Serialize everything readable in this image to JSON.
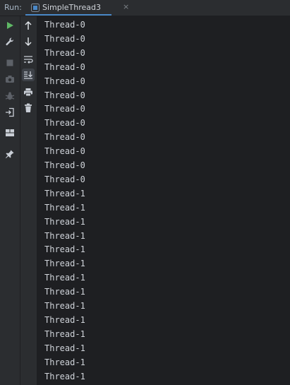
{
  "toolbar": {
    "run_label": "Run:",
    "tab_label": "SimpleThread3",
    "tab_close": "×"
  },
  "left_tools": [
    {
      "name": "run-icon"
    },
    {
      "name": "wrench-icon"
    },
    {
      "name": "stop-icon"
    },
    {
      "name": "camera-icon"
    },
    {
      "name": "bug-icon"
    },
    {
      "name": "login-icon"
    },
    {
      "name": "layout-icon"
    },
    {
      "name": "pin-icon"
    }
  ],
  "console_tools": [
    {
      "name": "arrow-up-icon"
    },
    {
      "name": "arrow-down-icon"
    },
    {
      "name": "soft-wrap-icon"
    },
    {
      "name": "scroll-to-end-icon"
    },
    {
      "name": "print-icon"
    },
    {
      "name": "trash-icon"
    }
  ],
  "console": {
    "lines": [
      "Thread-0",
      "Thread-0",
      "Thread-0",
      "Thread-0",
      "Thread-0",
      "Thread-0",
      "Thread-0",
      "Thread-0",
      "Thread-0",
      "Thread-0",
      "Thread-0",
      "Thread-0",
      "Thread-1",
      "Thread-1",
      "Thread-1",
      "Thread-1",
      "Thread-1",
      "Thread-1",
      "Thread-1",
      "Thread-1",
      "Thread-1",
      "Thread-1",
      "Thread-1",
      "Thread-1",
      "Thread-1",
      "Thread-1"
    ]
  },
  "colors": {
    "background": "#2b2d30",
    "console_bg": "#1e1f22",
    "text": "#cfd3d9",
    "accent": "#4a88c7",
    "run_green": "#5fb865"
  }
}
